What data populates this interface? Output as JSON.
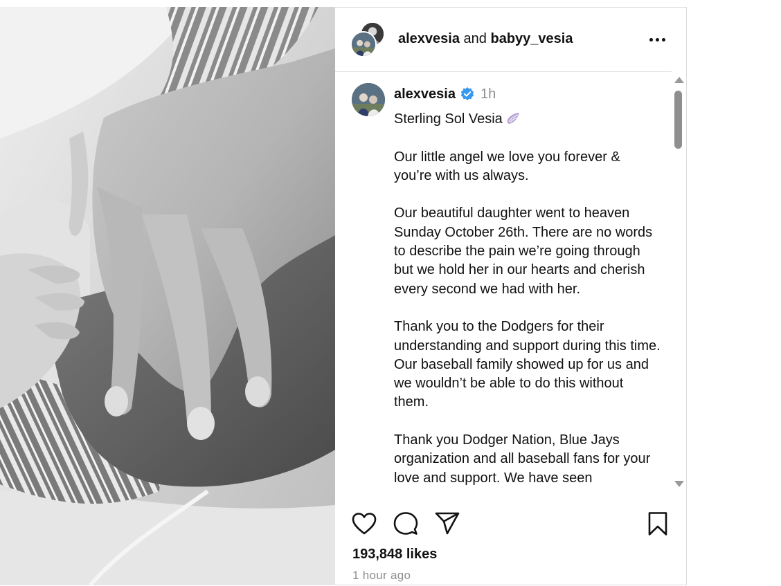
{
  "header": {
    "user1": "alexvesia",
    "connector": "and",
    "user2": "babyy_vesia"
  },
  "caption": {
    "username": "alexvesia",
    "verified": true,
    "time": "1h",
    "title": "Sterling Sol Vesia",
    "paragraphs": [
      "Our little angel we love you forever & you’re with us always.",
      "Our beautiful daughter went to heaven Sunday October 26th. There are no words to describe the pain we’re going through but we hold her in our hearts and cherish every second we had with her.",
      "Thank you to the Dodgers for their understanding and support during this time. Our baseball family showed up for us and we wouldn’t be able to do this without them.",
      "Thank you Dodger Nation, Blue Jays organization and all baseball fans for your love and support. We have seen"
    ]
  },
  "stats": {
    "likes": "193,848 likes",
    "posted": "1 hour ago"
  },
  "icons": {
    "more": "more-options-icon",
    "verified": "verified-badge-icon",
    "wing": "angel-wing-icon",
    "like": "heart-icon",
    "comment": "comment-bubble-icon",
    "share": "paper-plane-icon",
    "save": "bookmark-icon"
  },
  "colors": {
    "verified": "#3897f0",
    "muted": "#8e8e8e",
    "wing": "#b9a6d6"
  }
}
